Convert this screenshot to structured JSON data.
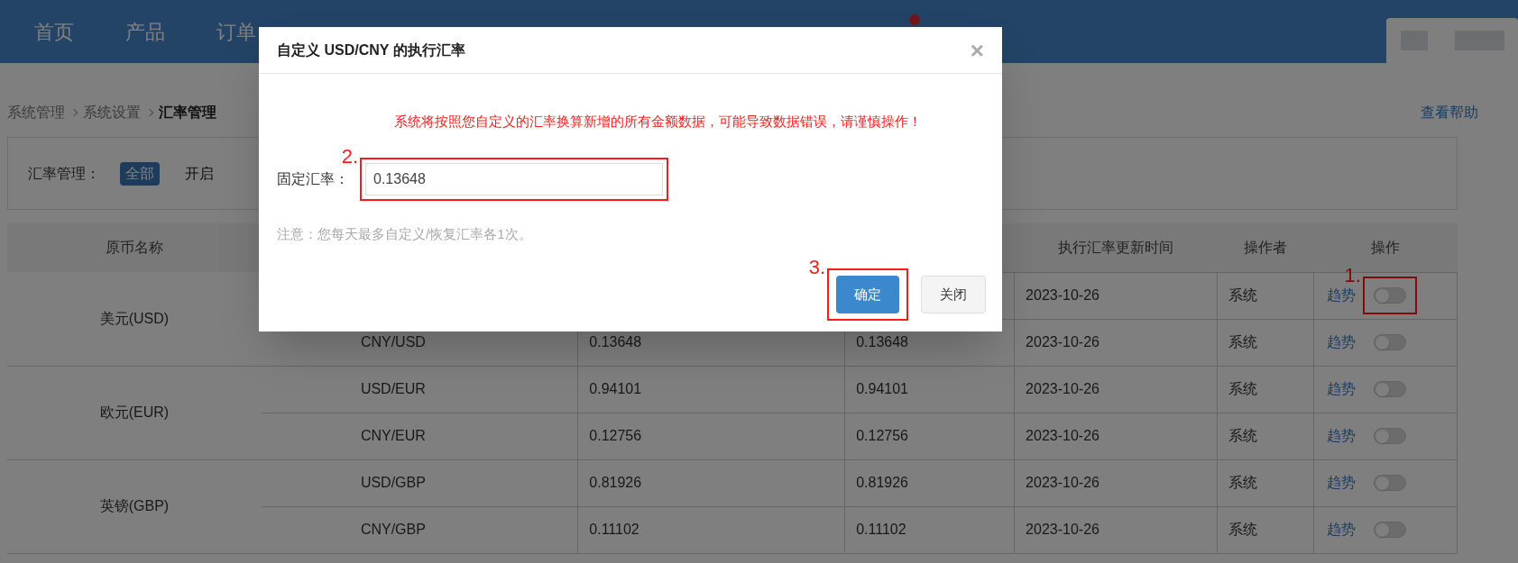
{
  "nav": {
    "items": [
      "首页",
      "产品",
      "订单"
    ],
    "has_alert": true
  },
  "breadcrumb": [
    "系统管理",
    "系统设置",
    "汇率管理"
  ],
  "help_link": "查看帮助",
  "filter": {
    "label": "汇率管理：",
    "options": [
      {
        "label": "全部",
        "selected": true
      },
      {
        "label": "开启",
        "selected": false
      }
    ]
  },
  "table": {
    "columns": {
      "column_1": "原币名称",
      "column_5": "执行汇率更新时间",
      "column_6": "操作者",
      "column_7": "操作"
    },
    "groups": [
      {
        "currency": "美元(USD)",
        "rows": [
          {
            "updated": "2023-10-26",
            "operator": "系统",
            "link": "趋势",
            "on": false,
            "annotation": "1."
          },
          {
            "pair": "CNY/USD",
            "rate": "0.13648",
            "exec_rate": "0.13648",
            "updated": "2023-10-26",
            "operator": "系统",
            "link": "趋势",
            "on": false
          }
        ]
      },
      {
        "currency": "欧元(EUR)",
        "rows": [
          {
            "pair": "USD/EUR",
            "rate": "0.94101",
            "exec_rate": "0.94101",
            "updated": "2023-10-26",
            "operator": "系统",
            "link": "趋势",
            "on": false
          },
          {
            "pair": "CNY/EUR",
            "rate": "0.12756",
            "exec_rate": "0.12756",
            "updated": "2023-10-26",
            "operator": "系统",
            "link": "趋势",
            "on": false
          }
        ]
      },
      {
        "currency": "英镑(GBP)",
        "rows": [
          {
            "pair": "USD/GBP",
            "rate": "0.81926",
            "exec_rate": "0.81926",
            "updated": "2023-10-26",
            "operator": "系统",
            "link": "趋势",
            "on": false
          },
          {
            "pair": "CNY/GBP",
            "rate": "0.11102",
            "exec_rate": "0.11102",
            "updated": "2023-10-26",
            "operator": "系统",
            "link": "趋势",
            "on": false
          }
        ]
      }
    ]
  },
  "dialog": {
    "title": "自定义 USD/CNY 的执行汇率",
    "close": "×",
    "warning": "系统将按照您自定义的汇率换算新增的所有金额数据，可能导致数据错误，请谨慎操作！",
    "field": {
      "label": "固定汇率：",
      "value": "0.13648",
      "annotation": "2."
    },
    "note": "注意：您每天最多自定义/恢复汇率各1次。",
    "confirm": {
      "label": "确定",
      "annotation": "3."
    },
    "cancel": "关闭"
  }
}
